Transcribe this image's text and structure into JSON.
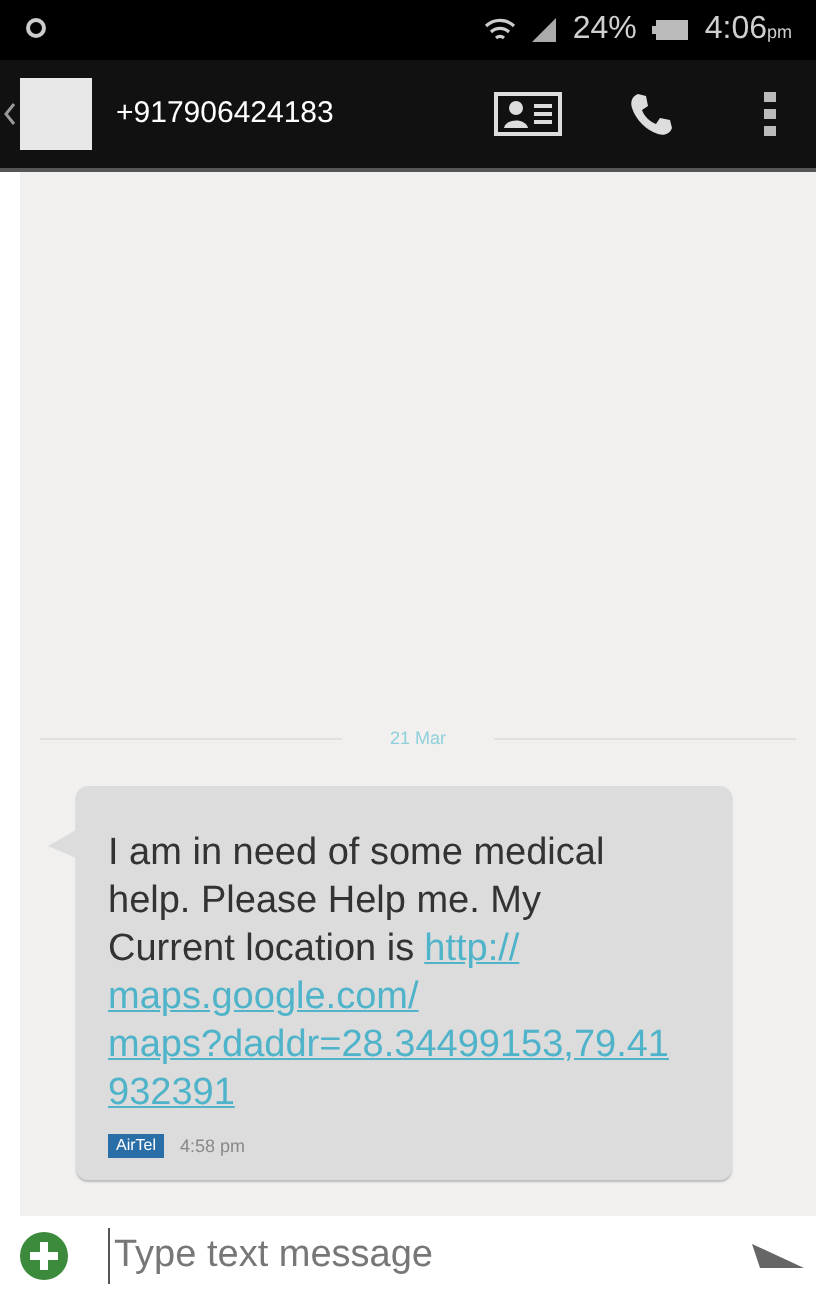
{
  "status_bar": {
    "battery": "24%",
    "time": "4:06",
    "ampm": "pm"
  },
  "header": {
    "contact": "+917906424183"
  },
  "date_divider": "21 Mar",
  "message": {
    "text_lines": [
      "I am in need of some medical",
      "help. Please Help me. My",
      "Current location is"
    ],
    "link_lines": [
      "http://",
      "maps.google.com/",
      "maps?daddr=28.34499153,79.41",
      "932391"
    ],
    "carrier": "AirTel",
    "time": "4:58 pm"
  },
  "composer": {
    "placeholder": "Type text message"
  }
}
